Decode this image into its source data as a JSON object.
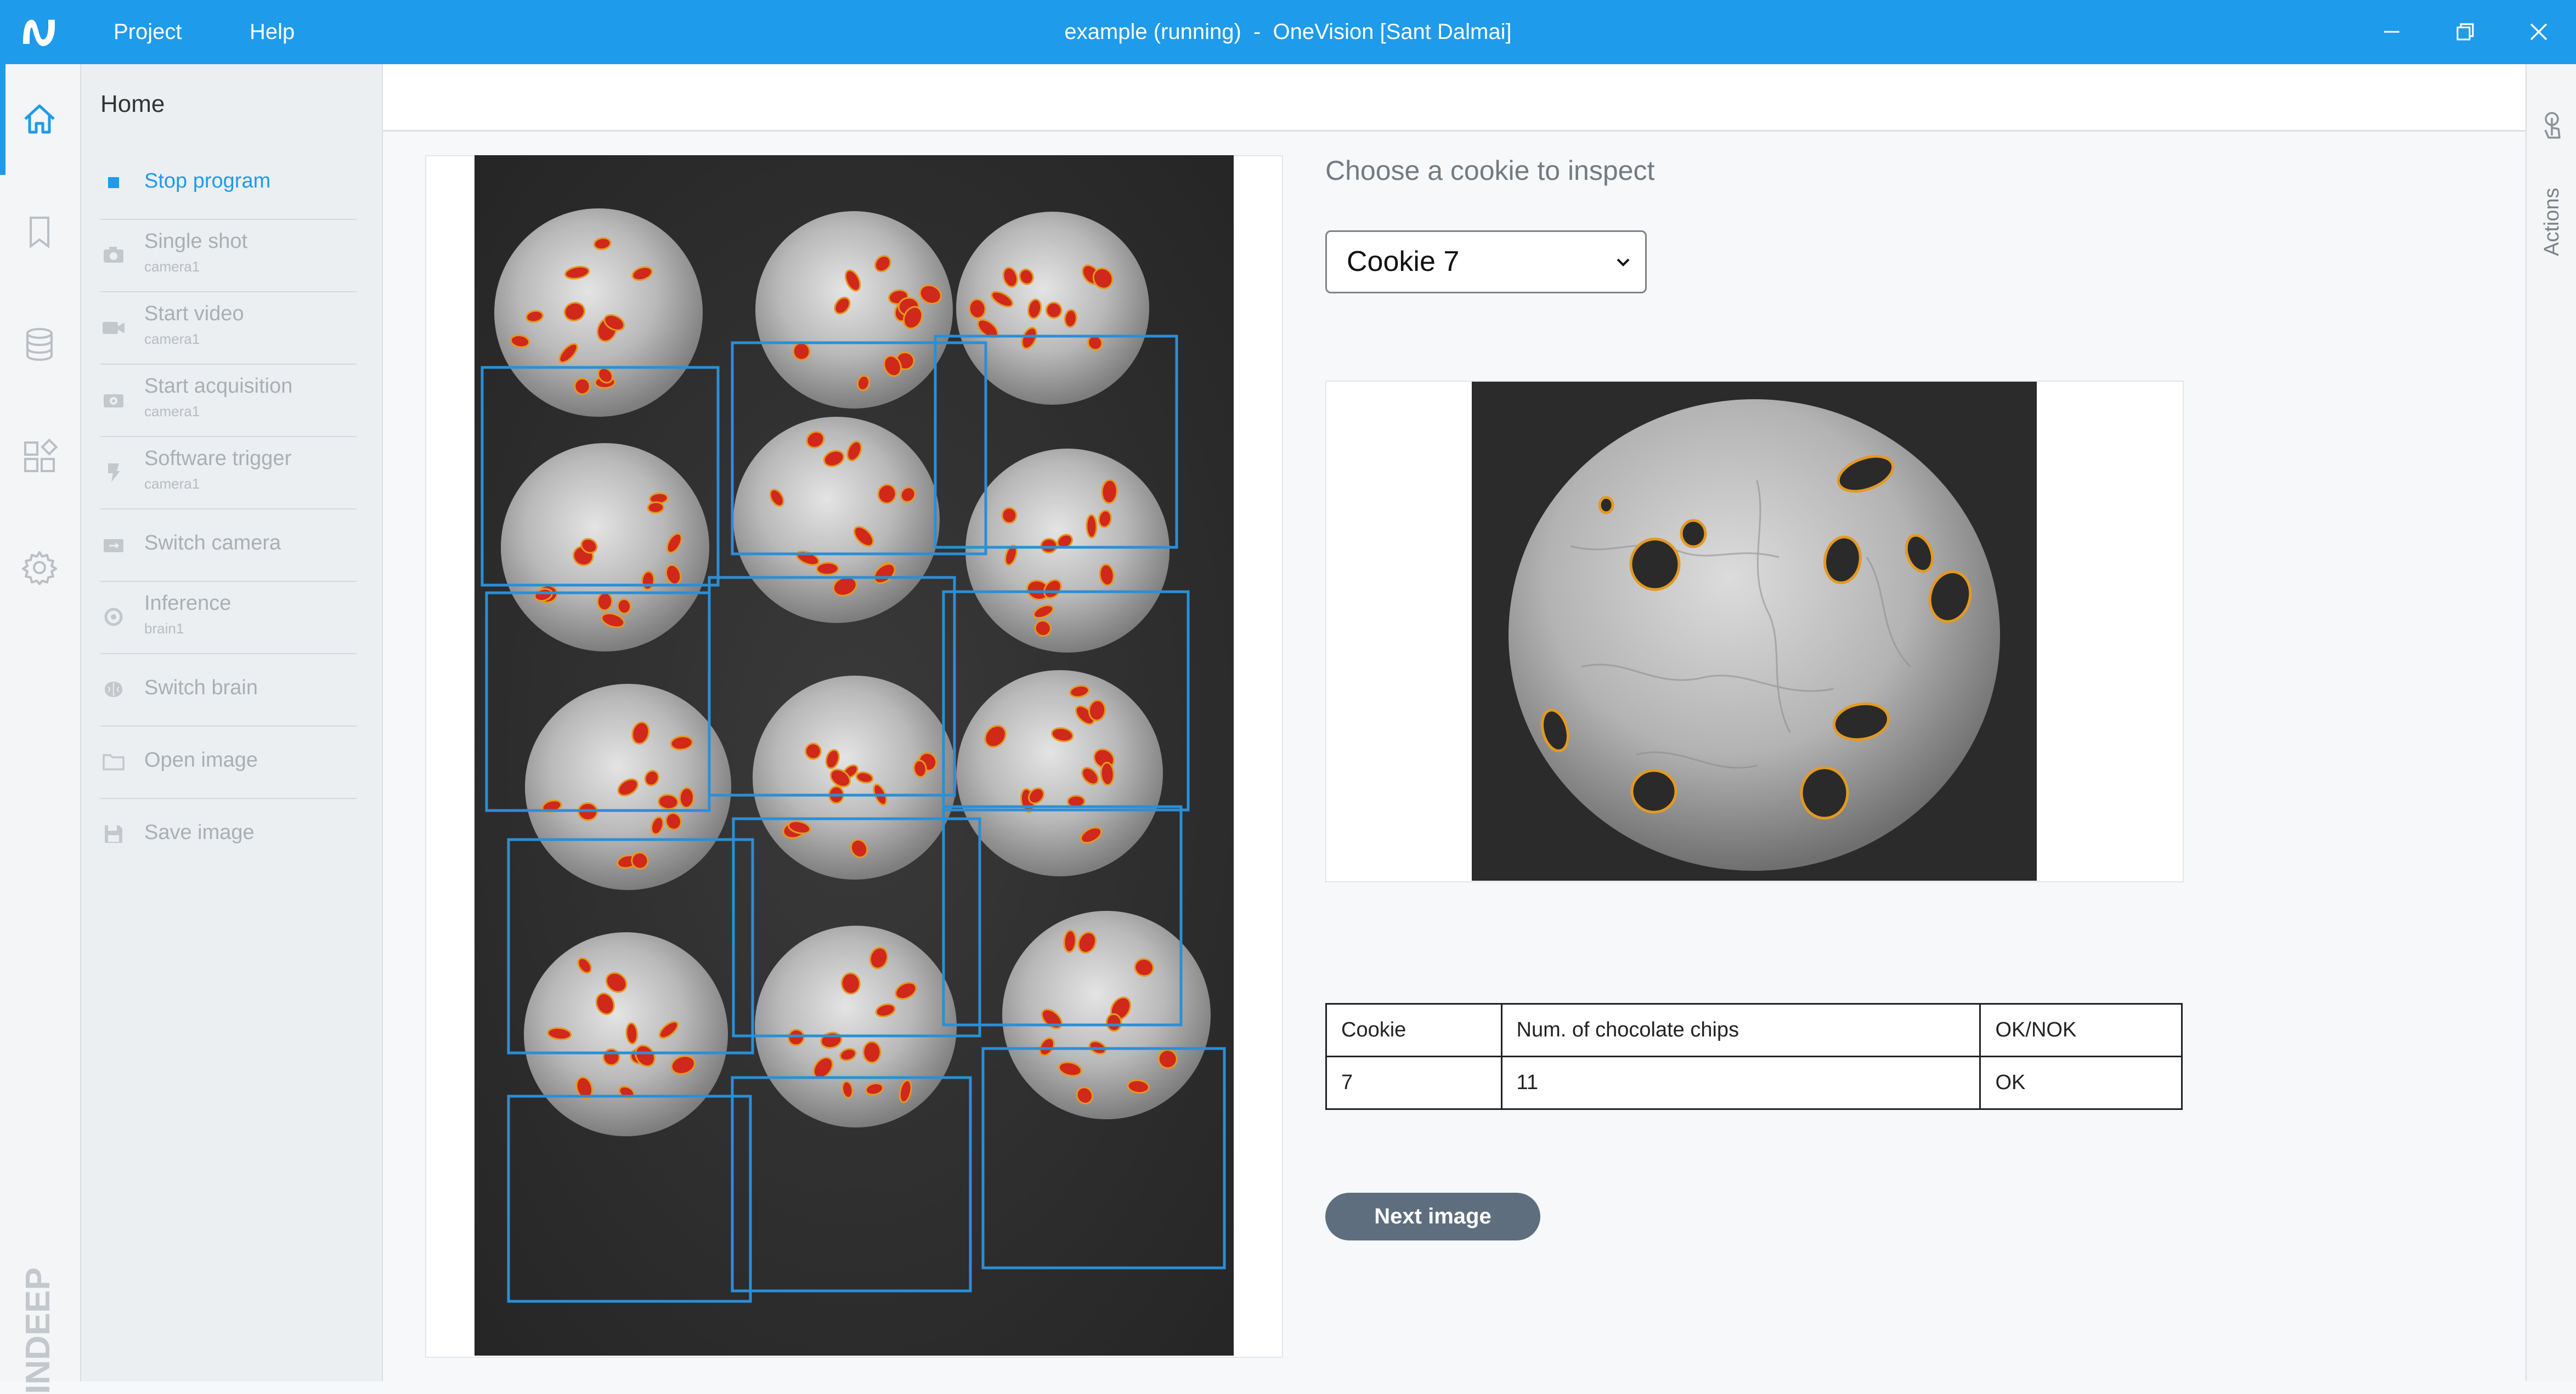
{
  "titlebar": {
    "menu": [
      {
        "label": "Project"
      },
      {
        "label": "Help"
      }
    ],
    "title": "example (running)  -  OneVision [Sant Dalmai]",
    "window_controls": [
      "minimize-icon",
      "restore-icon",
      "close-icon"
    ]
  },
  "rail": {
    "icons": [
      "home-icon",
      "bookmark-icon",
      "database-icon",
      "apps-icon",
      "settings-icon"
    ],
    "active": "home-icon",
    "brand": "INDEEP"
  },
  "panel": {
    "title": "Home",
    "actions": [
      {
        "label": "Stop program",
        "sub": "",
        "icon": "stop-icon",
        "active": true
      },
      {
        "label": "Single shot",
        "sub": "camera1",
        "icon": "camera-icon"
      },
      {
        "label": "Start video",
        "sub": "camera1",
        "icon": "video-icon"
      },
      {
        "label": "Start acquisition",
        "sub": "camera1",
        "icon": "acquisition-icon"
      },
      {
        "label": "Software trigger",
        "sub": "camera1",
        "icon": "trigger-icon"
      },
      {
        "label": "Switch camera",
        "sub": "",
        "icon": "switch-camera-icon"
      },
      {
        "label": "Inference",
        "sub": "brain1",
        "icon": "inference-icon"
      },
      {
        "label": "Switch brain",
        "sub": "",
        "icon": "brain-icon"
      },
      {
        "label": "Open image",
        "sub": "",
        "icon": "folder-icon"
      },
      {
        "label": "Save image",
        "sub": "",
        "icon": "save-icon"
      }
    ]
  },
  "right_rail": {
    "label": "Actions",
    "icon": "touch-icon"
  },
  "main": {
    "choose_label": "Choose a cookie to inspect",
    "select": {
      "value": "Cookie 7"
    },
    "table": {
      "headers": [
        "Cookie",
        "Num. of chocolate chips",
        "OK/NOK"
      ],
      "rows": [
        [
          "7",
          "11",
          "OK"
        ]
      ]
    },
    "next_button": "Next image"
  },
  "colors": {
    "accent": "#1e9bea",
    "detection_box": "#2a8fd6",
    "chip_highlight": "#d0281a",
    "chip_outline": "#e39a22",
    "button": "#5e6e7e"
  }
}
